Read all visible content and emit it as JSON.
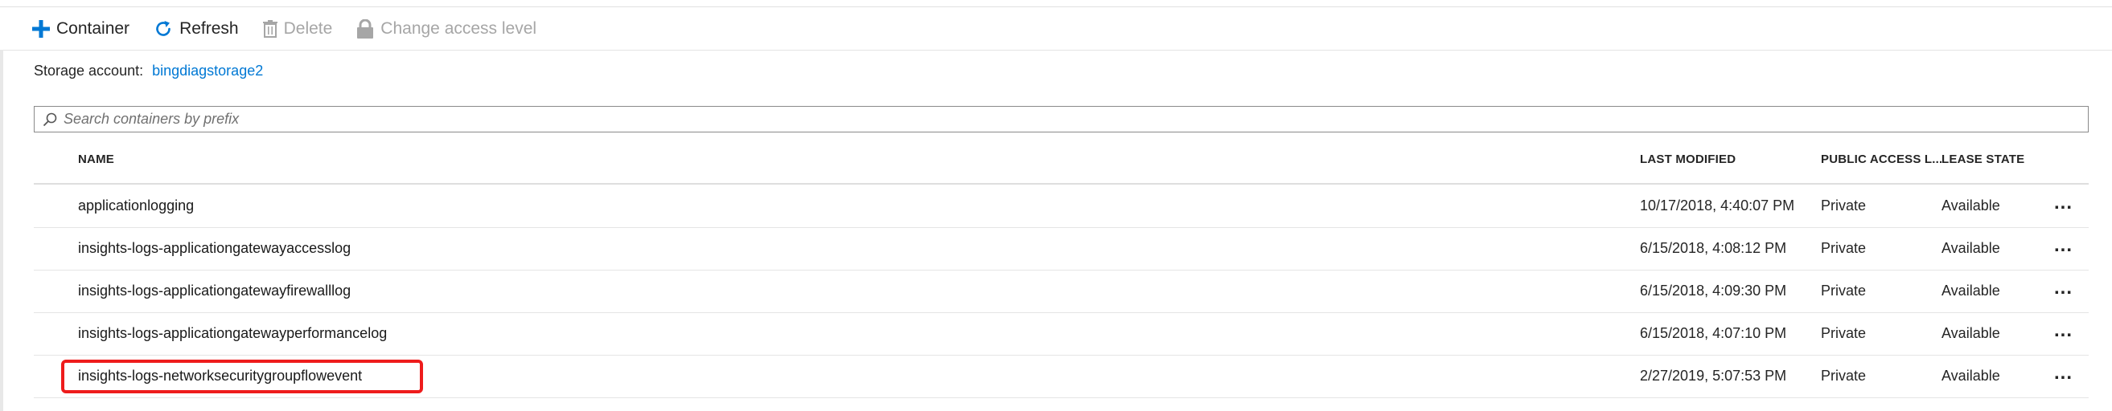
{
  "toolbar": {
    "container_label": "Container",
    "refresh_label": "Refresh",
    "delete_label": "Delete",
    "access_label": "Change access level"
  },
  "account": {
    "label": "Storage account:",
    "name": "bingdiagstorage2"
  },
  "search": {
    "placeholder": "Search containers by prefix"
  },
  "table": {
    "columns": [
      "NAME",
      "LAST MODIFIED",
      "PUBLIC ACCESS L...",
      "LEASE STATE"
    ],
    "rows": [
      {
        "name": "applicationlogging",
        "modified": "10/17/2018, 4:40:07 PM",
        "access": "Private",
        "lease": "Available",
        "more": "..."
      },
      {
        "name": "insights-logs-applicationgatewayaccesslog",
        "modified": "6/15/2018, 4:08:12 PM",
        "access": "Private",
        "lease": "Available",
        "more": "..."
      },
      {
        "name": "insights-logs-applicationgatewayfirewalllog",
        "modified": "6/15/2018, 4:09:30 PM",
        "access": "Private",
        "lease": "Available",
        "more": "..."
      },
      {
        "name": "insights-logs-applicationgatewayperformancelog",
        "modified": "6/15/2018, 4:07:10 PM",
        "access": "Private",
        "lease": "Available",
        "more": "..."
      },
      {
        "name": "insights-logs-networksecuritygroupflowevent",
        "modified": "2/27/2019, 5:07:53 PM",
        "access": "Private",
        "lease": "Available",
        "more": "..."
      }
    ]
  },
  "colors": {
    "accent": "#0078d4",
    "highlight": "#ee1c1c",
    "disabled": "#a6a6a6"
  },
  "icons": {
    "container": "plus-icon",
    "refresh": "refresh-icon",
    "delete": "trash-icon",
    "access": "lock-icon",
    "search": "search-icon"
  }
}
